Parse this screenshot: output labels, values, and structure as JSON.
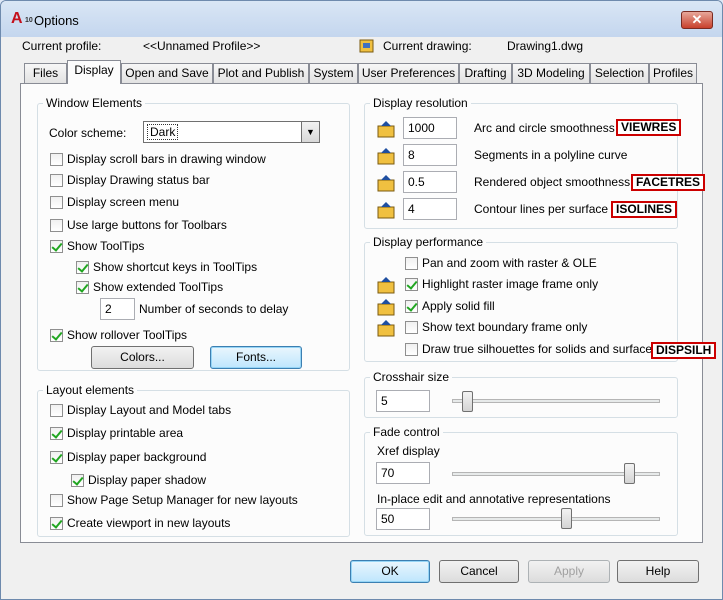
{
  "window": {
    "title": "Options",
    "close": "✕"
  },
  "profile": {
    "label": "Current profile:",
    "value": "<<Unnamed Profile>>",
    "drawing_label": "Current drawing:",
    "drawing_value": "Drawing1.dwg"
  },
  "tabs": [
    "Files",
    "Display",
    "Open and Save",
    "Plot and Publish",
    "System",
    "User Preferences",
    "Drafting",
    "3D Modeling",
    "Selection",
    "Profiles"
  ],
  "window_elements": {
    "title": "Window Elements",
    "color_scheme_label": "Color scheme:",
    "color_scheme_value": "Dark",
    "items": [
      {
        "label": "Display scroll bars in drawing window",
        "checked": false
      },
      {
        "label": "Display Drawing status bar",
        "checked": false
      },
      {
        "label": "Display screen menu",
        "checked": false
      },
      {
        "label": "Use large buttons for Toolbars",
        "checked": false
      },
      {
        "label": "Show ToolTips",
        "checked": true
      },
      {
        "label": "Show shortcut keys in ToolTips",
        "checked": true
      },
      {
        "label": "Show extended ToolTips",
        "checked": true
      },
      {
        "label": "Show rollover ToolTips",
        "checked": true
      }
    ],
    "delay_value": "2",
    "delay_label": "Number of seconds to delay",
    "colors_button": "Colors...",
    "fonts_button": "Fonts..."
  },
  "layout_elements": {
    "title": "Layout elements",
    "items": [
      {
        "label": "Display Layout and Model tabs",
        "checked": false
      },
      {
        "label": "Display printable area",
        "checked": true
      },
      {
        "label": "Display paper background",
        "checked": true
      },
      {
        "label": "Display paper shadow",
        "checked": true
      },
      {
        "label": "Show Page Setup Manager for new layouts",
        "checked": false
      },
      {
        "label": "Create viewport in new layouts",
        "checked": true
      }
    ]
  },
  "display_resolution": {
    "title": "Display resolution",
    "items": [
      {
        "value": "1000",
        "label": "Arc and circle smoothness",
        "sysvar": "VIEWRES"
      },
      {
        "value": "8",
        "label": "Segments in a polyline curve",
        "sysvar": ""
      },
      {
        "value": "0.5",
        "label": "Rendered object smoothness",
        "sysvar": "FACETRES"
      },
      {
        "value": "4",
        "label": "Contour lines per surface",
        "sysvar": "ISOLINES"
      }
    ]
  },
  "display_performance": {
    "title": "Display performance",
    "items": [
      {
        "label": "Pan and zoom with raster & OLE",
        "checked": false
      },
      {
        "label": "Highlight raster image frame only",
        "checked": true
      },
      {
        "label": "Apply solid fill",
        "checked": true
      },
      {
        "label": "Show text boundary frame only",
        "checked": false
      },
      {
        "label": "Draw true silhouettes for solids and surfaces",
        "checked": false
      }
    ],
    "sysvar": "DISPSILH"
  },
  "crosshair": {
    "title": "Crosshair size",
    "value": "5",
    "level_percent": 5
  },
  "fade": {
    "title": "Fade control",
    "xref_label": "Xref display",
    "xref_value": "70",
    "inplace_label": "In-place edit and annotative representations",
    "inplace_value": "50"
  },
  "buttons": {
    "ok": "OK",
    "cancel": "Cancel",
    "apply": "Apply",
    "help": "Help"
  },
  "colors": {
    "title_bar": "#c4d6ee",
    "close": "#c8402c",
    "sysvar_border": "#cc0000",
    "check": "#21a621"
  }
}
